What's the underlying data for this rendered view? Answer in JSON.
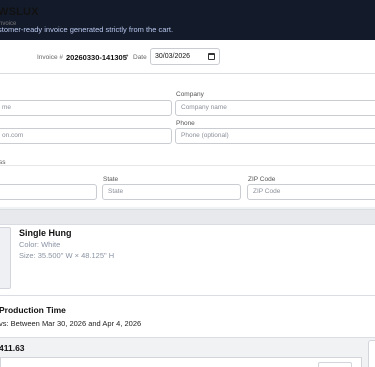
{
  "banner": {
    "subtitle": "stomer-ready invoice generated strictly from the cart."
  },
  "invoice": {
    "brand": "WSLUX",
    "brand_sub": "nvoice",
    "number_label": "Invoice #",
    "number": "20260330-141305",
    "separator": "•",
    "date_label": "Date",
    "date_value": "30/03/2026"
  },
  "form": {
    "name_placeholder": "me",
    "company_label": "Company",
    "company_placeholder": "Company name",
    "email_placeholder": "on.com",
    "phone_label": "Phone",
    "phone_placeholder": "Phone (optional)",
    "address_label": "ss",
    "state_label": "State",
    "state_placeholder": "State",
    "zip_label": "ZIP Code",
    "zip_placeholder": "ZIP Code"
  },
  "product": {
    "name": "Single Hung",
    "color": "Color: White",
    "size": "Size: 35.500\" W × 48.125\" H"
  },
  "production": {
    "title": "Production Time",
    "text": "vs: Between Mar 30, 2026 and Apr 4, 2026"
  },
  "totals": {
    "amount": "411.63"
  },
  "icons": {
    "date": "calendar-icon"
  }
}
